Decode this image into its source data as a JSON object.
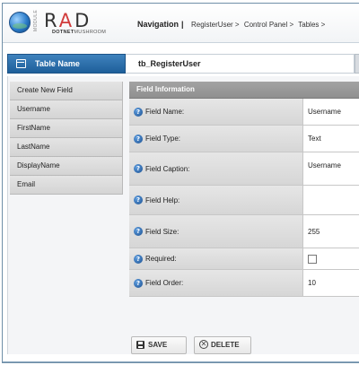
{
  "logo": {
    "vertical_text": "MODULE",
    "name_prefix": "R",
    "name_accent": "A",
    "name_suffix": "D",
    "sub_bold": "DOTNET",
    "sub_rest": "MUSHROOM"
  },
  "navigation": {
    "title": "Navigation",
    "separator": "|",
    "breadcrumbs": [
      "RegisterUser >",
      "Control Panel >",
      "Tables >"
    ]
  },
  "table": {
    "label": "Table Name",
    "value": "tb_RegisterUser"
  },
  "field_list": [
    "Create New Field",
    "Username",
    "FirstName",
    "LastName",
    "DisplayName",
    "Email"
  ],
  "form": {
    "header": "Field Information",
    "rows": [
      {
        "label": "Field Name:",
        "value": "Username"
      },
      {
        "label": "Field Type:",
        "value": "Text"
      },
      {
        "label": "Field Caption:",
        "value": "Username"
      },
      {
        "label": "Field Help:",
        "value": ""
      },
      {
        "label": "Field Size:",
        "value": "255"
      },
      {
        "label": "Required:",
        "checked": false
      },
      {
        "label": "Field Order:",
        "value": "10"
      }
    ],
    "help_icon": "?"
  },
  "buttons": {
    "save": "SAVE",
    "delete": "DELETE"
  },
  "colors": {
    "table_label_bg": "#2a6fae",
    "form_header_bg": "#999999",
    "list_item_bg": "#dcdcdc"
  }
}
